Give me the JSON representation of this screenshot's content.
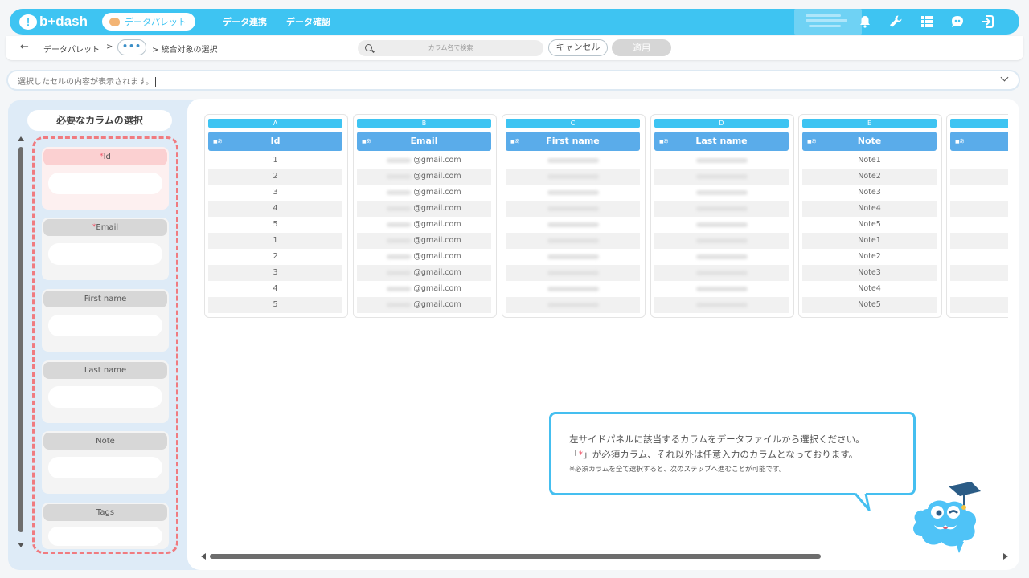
{
  "header": {
    "logo_text": "b+dash",
    "palette_pill": "データパレット",
    "nav": [
      "データ連携",
      "データ確認"
    ],
    "icons": [
      "bell-icon",
      "wrench-icon",
      "grid-icon",
      "mascot-icon",
      "logout-icon"
    ]
  },
  "breadcrumb": {
    "back": "←",
    "root": "データパレット",
    "sep": ">",
    "more": "•••",
    "current": "> 統合対象の選択"
  },
  "search": {
    "placeholder": "カラム名で検索"
  },
  "buttons": {
    "cancel": "キャンセル",
    "apply": "適用"
  },
  "cell_content": {
    "placeholder": "選択したセルの内容が表示されます。"
  },
  "left_panel": {
    "title": "必要なカラムの選択",
    "required_mark": "*",
    "slots": [
      {
        "label": "Id",
        "required": true,
        "highlighted": true
      },
      {
        "label": "Email",
        "required": true,
        "highlighted": false
      },
      {
        "label": "First name",
        "required": false,
        "highlighted": false
      },
      {
        "label": "Last name",
        "required": false,
        "highlighted": false
      },
      {
        "label": "Note",
        "required": false,
        "highlighted": false
      },
      {
        "label": "Tags",
        "required": false,
        "highlighted": false
      }
    ]
  },
  "table": {
    "type_icon": "■あ",
    "columns": [
      {
        "letter": "A",
        "name": "Id"
      },
      {
        "letter": "B",
        "name": "Email"
      },
      {
        "letter": "C",
        "name": "First name"
      },
      {
        "letter": "D",
        "name": "Last name"
      },
      {
        "letter": "E",
        "name": "Note"
      },
      {
        "letter": "",
        "name": ""
      }
    ],
    "ids": [
      "1",
      "2",
      "3",
      "4",
      "5",
      "1",
      "2",
      "3",
      "4",
      "5"
    ],
    "email_suffix": "@gmail.com",
    "notes": [
      "Note1",
      "Note2",
      "Note3",
      "Note4",
      "Note5",
      "Note1",
      "Note2",
      "Note3",
      "Note4",
      "Note5"
    ]
  },
  "tooltip": {
    "line1": "左サイドパネルに該当するカラムをデータファイルから選択ください。",
    "line2_pre": "「",
    "line2_star": "*",
    "line2_post": "」が必須カラム、それ以外は任意入力のカラムとなっております。",
    "line3": "※必須カラムを全て選択すると、次のステップへ進むことが可能です。"
  },
  "colors": {
    "accent": "#3ec4f2",
    "header_blue": "#5aacea",
    "required_red": "#f0566a",
    "dash_red": "#f07b80"
  }
}
